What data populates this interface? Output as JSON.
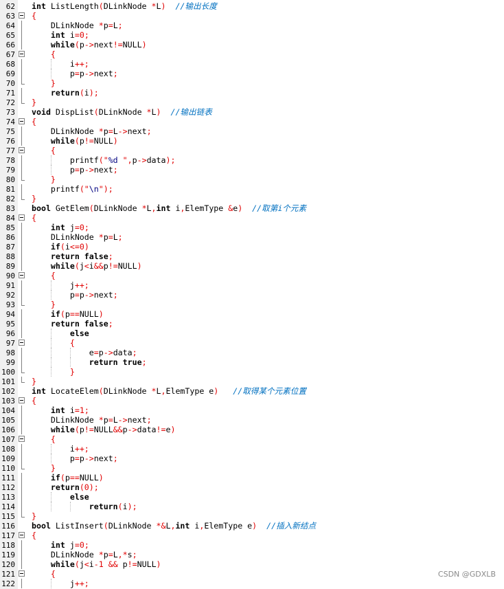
{
  "editor": {
    "first_line_number": 62,
    "watermark": "CSDN @GDXLB",
    "colors": {
      "keyword": "#000000",
      "operator": "#e00000",
      "string": "#000080",
      "comment": "#0070c0",
      "gutter": "#f0f0f0"
    },
    "lines": [
      "int ListLength(DLinkNode *L)  //输出长度",
      "{",
      "    DLinkNode *p=L;",
      "    int i=0;",
      "    while(p->next!=NULL)",
      "    {",
      "        i++;",
      "        p=p->next;",
      "    }",
      "    return(i);",
      "}",
      "void DispList(DLinkNode *L)  //输出链表",
      "{",
      "    DLinkNode *p=L->next;",
      "    while(p!=NULL)",
      "    {",
      "        printf(\"%d \",p->data);",
      "        p=p->next;",
      "    }",
      "    printf(\"\\n\");",
      "}",
      "bool GetElem(DLinkNode *L,int i,ElemType &e)  //取第i个元素",
      "{",
      "    int j=0;",
      "    DLinkNode *p=L;",
      "    if(i<=0)",
      "    return false;",
      "    while(j<i&&p!=NULL)",
      "    {",
      "        j++;",
      "        p=p->next;",
      "    }",
      "    if(p==NULL)",
      "    return false;",
      "        else",
      "        {",
      "            e=p->data;",
      "            return true;",
      "        }",
      "}",
      "int LocateElem(DLinkNode *L,ElemType e)   //取得某个元素位置",
      "{",
      "    int i=1;",
      "    DLinkNode *p=L->next;",
      "    while(p!=NULL&&p->data!=e)",
      "    {",
      "        i++;",
      "        p=p->next;",
      "    }",
      "    if(p==NULL)",
      "    return(0);",
      "        else",
      "            return(i);",
      "}",
      "bool ListInsert(DLinkNode *&L,int i,ElemType e)  //插入新结点",
      "{",
      "    int j=0;",
      "    DLinkNode *p=L,*s;",
      "    while(j<i-1 && p!=NULL)",
      "    {",
      "        j++;"
    ],
    "fold_markers": [
      "",
      "box",
      "line",
      "line",
      "line",
      "box",
      "line",
      "line",
      "end",
      "line",
      "end",
      "",
      "box",
      "line",
      "line",
      "box",
      "line",
      "line",
      "end",
      "line",
      "end",
      "",
      "box",
      "line",
      "line",
      "line",
      "line",
      "line",
      "box",
      "line",
      "line",
      "end",
      "line",
      "line",
      "line",
      "box",
      "line",
      "line",
      "end",
      "end",
      "",
      "box",
      "line",
      "line",
      "line",
      "box",
      "line",
      "line",
      "end",
      "line",
      "line",
      "line",
      "line",
      "end",
      "",
      "box",
      "line",
      "line",
      "line",
      "box",
      "line"
    ]
  }
}
